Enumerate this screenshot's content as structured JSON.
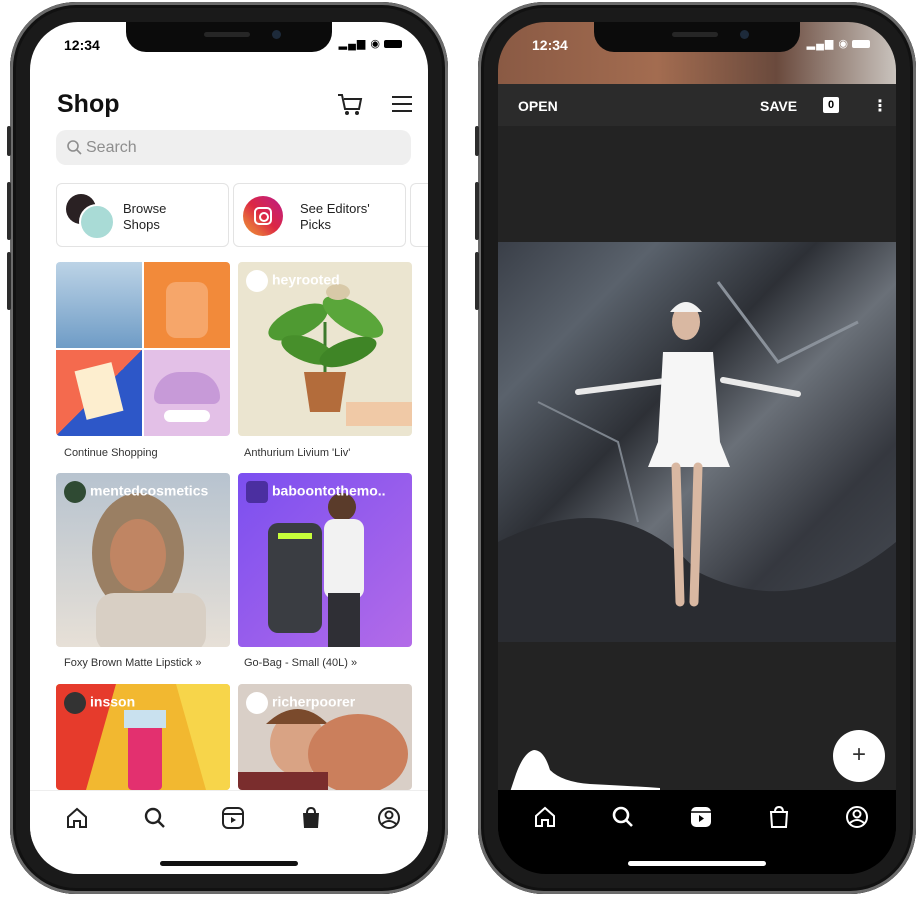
{
  "left_phone": {
    "status": {
      "time": "12:34",
      "signal": "▂▄▆ ◉"
    },
    "header": {
      "title": "Shop"
    },
    "search": {
      "placeholder": "Search"
    },
    "chips": [
      {
        "label": "Browse\nShops"
      },
      {
        "label": "See Editors'\nPicks"
      }
    ],
    "tiles": [
      {
        "handle": "",
        "caption": "Continue Shopping"
      },
      {
        "handle": "heyrooted",
        "caption": "Anthurium Livium 'Liv'"
      },
      {
        "handle": "mentedcosmetics",
        "caption": "Foxy Brown Matte Lipstick »"
      },
      {
        "handle": "baboontothemo..",
        "caption": "Go-Bag - Small (40L) »"
      },
      {
        "handle": "insson",
        "caption": ""
      },
      {
        "handle": "richerpoorer",
        "caption": ""
      }
    ],
    "tabbar": [
      "home-icon",
      "search-icon",
      "reels-icon",
      "shop-bag-icon",
      "profile-icon"
    ]
  },
  "right_phone": {
    "status": {
      "time": "12:34",
      "signal": "▂▄▆ ◉"
    },
    "editor": {
      "open_label": "OPEN",
      "save_label": "SAVE",
      "count": "0",
      "more": "⋮"
    },
    "fab": {
      "label": "+"
    },
    "tabbar": [
      "home-icon",
      "search-icon",
      "reels-icon",
      "shop-bag-icon",
      "profile-icon"
    ]
  },
  "colors": {
    "accent_ig": "#dc2743",
    "editor_bg": "#232323",
    "shop_bg": "#ffffff"
  }
}
